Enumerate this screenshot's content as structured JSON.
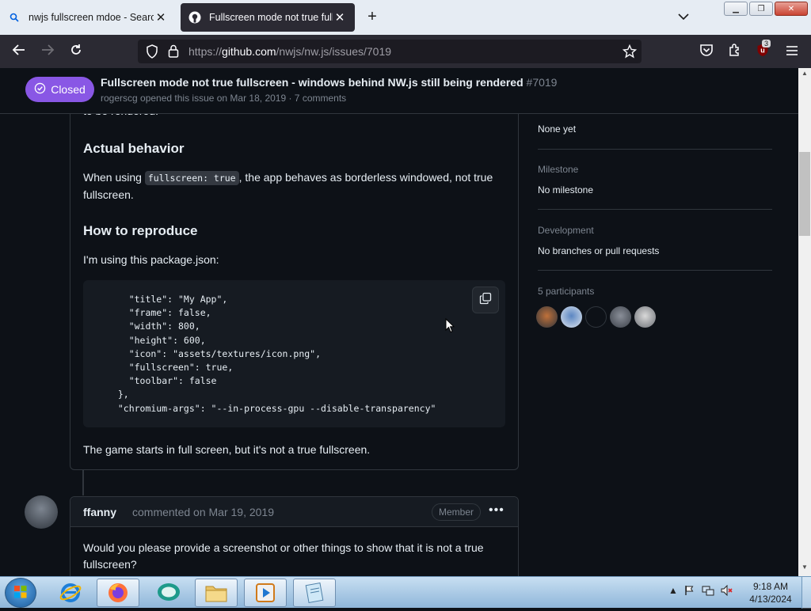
{
  "browser": {
    "tabs": [
      {
        "title": "nwjs fullscreen mdoe - Search",
        "active": false
      },
      {
        "title": "Fullscreen mode not true fullscr",
        "active": true
      }
    ],
    "url_prefix": "https://",
    "url_host": "github.com",
    "url_path": "/nwjs/nw.js/issues/7019",
    "extension_badge": "3"
  },
  "issue": {
    "status": "Closed",
    "title": "Fullscreen mode not true fullscreen - windows behind NW.js still being rendered",
    "number": "#7019",
    "meta": "rogerscg opened this issue on Mar 18, 2019 · 7 comments"
  },
  "body": {
    "cut_text": "to be rendered.",
    "actual_heading": "Actual behavior",
    "actual_pre": "When using ",
    "actual_code": "fullscreen: true",
    "actual_post": ", the app behaves as borderless windowed, not true fullscreen.",
    "repro_heading": "How to reproduce",
    "repro_text": "I'm using this package.json:",
    "code": "    \"title\": \"My App\",\n    \"frame\": false,\n    \"width\": 800,\n    \"height\": 600,\n    \"icon\": \"assets/textures/icon.png\",\n    \"fullscreen\": true,\n    \"toolbar\": false\n  },\n  \"chromium-args\": \"--in-process-gpu --disable-transparency\"",
    "after_code": "The game starts in full screen, but it's not a true fullscreen."
  },
  "comment": {
    "author": "ffanny",
    "action": "commented on Mar 19, 2019",
    "role": "Member",
    "text": "Would you please provide a screenshot or other things to show that it is not a true fullscreen?"
  },
  "sidebar": {
    "projects_value": "None yet",
    "milestone_label": "Milestone",
    "milestone_value": "No milestone",
    "development_label": "Development",
    "development_value": "No branches or pull requests",
    "participants_label": "5 participants",
    "participant_colors": [
      "#c0713a",
      "#5b86c2",
      "#0d1117",
      "#8a8f99",
      "#d9d9d9"
    ]
  },
  "taskbar": {
    "time": "9:18 AM",
    "date": "4/13/2024"
  },
  "colors": {
    "closed_purple": "#8957e5",
    "bg": "#0d1117",
    "border": "#30363d",
    "muted": "#7d8590"
  }
}
